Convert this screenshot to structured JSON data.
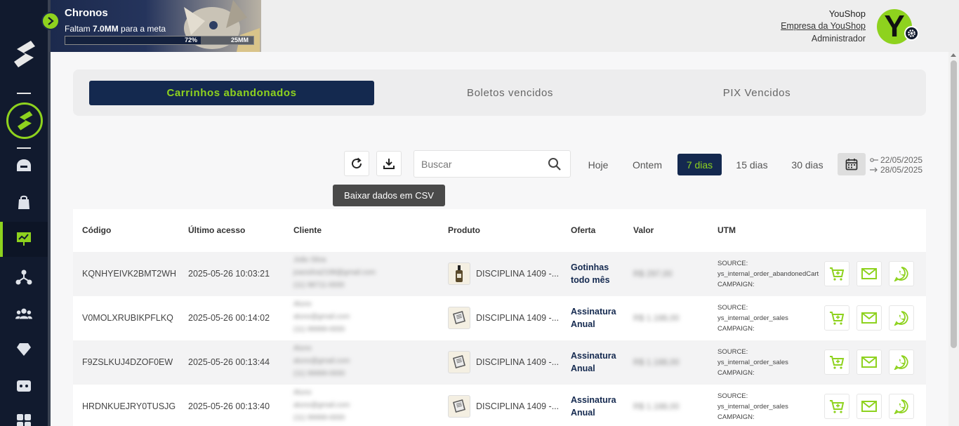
{
  "goal": {
    "title": "Chronos",
    "subtitle_prefix": "Faltam ",
    "subtitle_amount": "7.0MM",
    "subtitle_suffix": " para a meta",
    "progress_label": "72%",
    "progress_value": 72,
    "target_label": "25MM"
  },
  "user": {
    "name": "YouShop",
    "company": "Empresa da YouShop",
    "role": "Administrador",
    "avatar_letter": "Y"
  },
  "tabs": [
    {
      "label": "Carrinhos abandonados",
      "active": true
    },
    {
      "label": "Boletos vencidos",
      "active": false
    },
    {
      "label": "PIX Vencidos",
      "active": false
    }
  ],
  "toolbar": {
    "search_placeholder": "Buscar",
    "tooltip": "Baixar dados em CSV",
    "periods": [
      "Hoje",
      "Ontem",
      "7 dias",
      "15 dias",
      "30 dias"
    ],
    "active_period": "7 dias",
    "date_start": "22/05/2025",
    "date_end": "28/05/2025"
  },
  "table": {
    "headers": [
      "Código",
      "Último acesso",
      "Cliente",
      "Produto",
      "Oferta",
      "Valor",
      "UTM"
    ],
    "rows": [
      {
        "code": "KQNHYEIVK2BMT2WH",
        "last_access": "2025-05-26 10:03:21",
        "client_name": "João Silva",
        "client_email": "joaosilva2198@gmail.com",
        "client_phone": "(11) 98711-0000",
        "product": "DISCIPLINA 1409 -...",
        "offer_line1": "Gotinhas",
        "offer_line2": "todo mês",
        "value": "R$ 297,00",
        "utm_source_label": "SOURCE:",
        "utm_source": "ys_internal_order_abandonedCart",
        "utm_campaign_label": "CAMPAIGN:"
      },
      {
        "code": "V0MOLXRUBIKPFLKQ",
        "last_access": "2025-05-26 00:14:02",
        "client_name": "Aluno",
        "client_email": "aluno@gmail.com",
        "client_phone": "(11) 99999-0000",
        "product": "DISCIPLINA 1409 -...",
        "offer_line1": "Assinatura",
        "offer_line2": "Anual",
        "value": "R$ 1.188,00",
        "utm_source_label": "SOURCE:",
        "utm_source": "ys_internal_order_sales",
        "utm_campaign_label": "CAMPAIGN:"
      },
      {
        "code": "F9ZSLKUJ4DZOF0EW",
        "last_access": "2025-05-26 00:13:44",
        "client_name": "Aluno",
        "client_email": "aluno@gmail.com",
        "client_phone": "(11) 99999-0000",
        "product": "DISCIPLINA 1409 -...",
        "offer_line1": "Assinatura",
        "offer_line2": "Anual",
        "value": "R$ 1.188,00",
        "utm_source_label": "SOURCE:",
        "utm_source": "ys_internal_order_sales",
        "utm_campaign_label": "CAMPAIGN:"
      },
      {
        "code": "HRDNKUEJRY0TUSJG",
        "last_access": "2025-05-26 00:13:40",
        "client_name": "Aluno",
        "client_email": "aluno@gmail.com",
        "client_phone": "(11) 99999-0000",
        "product": "DISCIPLINA 1409 -...",
        "offer_line1": "Assinatura",
        "offer_line2": "Anual",
        "value": "R$ 1.188,00",
        "utm_source_label": "SOURCE:",
        "utm_source": "ys_internal_order_sales",
        "utm_campaign_label": "CAMPAIGN:"
      }
    ]
  },
  "colors": {
    "navy": "#14294f",
    "accent_green": "#8ed21e",
    "sidebar": "#111a2e"
  }
}
